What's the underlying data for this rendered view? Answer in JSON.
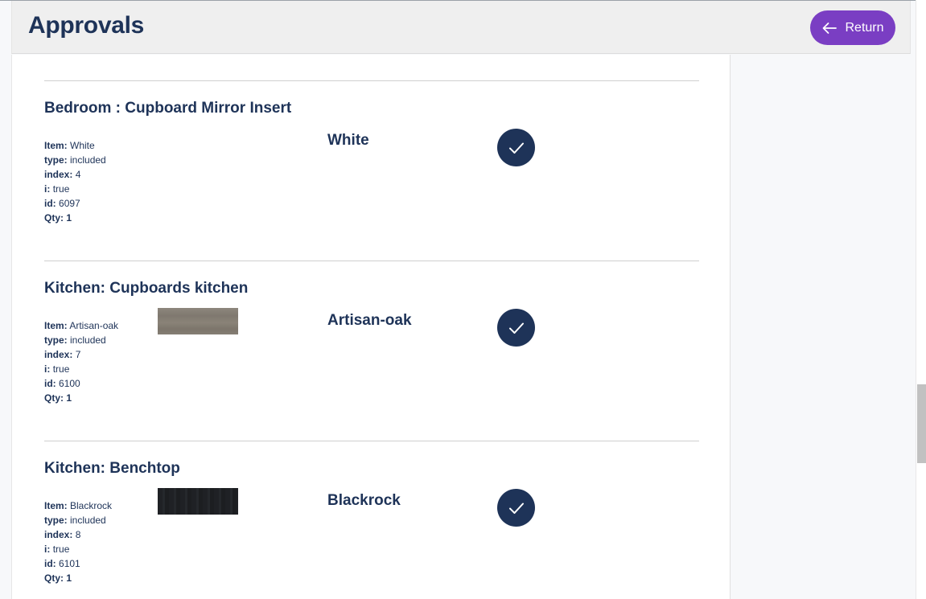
{
  "header": {
    "title": "Approvals",
    "return_label": "Return"
  },
  "items": [
    {
      "title": "Bedroom : Cupboard Mirror Insert",
      "item": "White",
      "type": "included",
      "index": "4",
      "i": "true",
      "id": "6097",
      "qty": "1",
      "choice": "White",
      "swatch": null
    },
    {
      "title": "Kitchen: Cupboards kitchen",
      "item": "Artisan-oak",
      "type": "included",
      "index": "7",
      "i": "true",
      "id": "6100",
      "qty": "1",
      "choice": "Artisan-oak",
      "swatch": "artisan-oak"
    },
    {
      "title": "Kitchen: Benchtop",
      "item": "Blackrock",
      "type": "included",
      "index": "8",
      "i": "true",
      "id": "6101",
      "qty": "1",
      "choice": "Blackrock",
      "swatch": "blackrock"
    }
  ],
  "labels": {
    "item": "Item:",
    "type": "type:",
    "index": "index:",
    "i": "i:",
    "id": "id:",
    "qty": "Qty:"
  },
  "colors": {
    "primary_navy": "#1e3358",
    "return_purple": "#7a3ec3"
  },
  "icons": {
    "return": "arrow-left-icon",
    "approve": "check-icon"
  }
}
